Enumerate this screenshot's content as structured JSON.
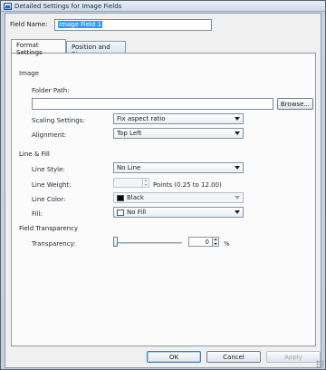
{
  "window": {
    "title": "Detailed Settings for Image Fields"
  },
  "field_name": {
    "label": "Field Name:",
    "value": "Image Field 1"
  },
  "tabs": [
    {
      "label": "Format Settings",
      "active": true
    },
    {
      "label": "Position and Size",
      "active": false
    }
  ],
  "image": {
    "heading": "Image",
    "folder_path_label": "Folder Path:",
    "folder_path_value": "",
    "browse_label": "Browse...",
    "scaling_label": "Scaling Settings:",
    "scaling_value": "Fix aspect ratio",
    "alignment_label": "Alignment:",
    "alignment_value": "Top Left"
  },
  "line_fill": {
    "heading": "Line & Fill",
    "line_style_label": "Line Style:",
    "line_style_value": "No Line",
    "line_weight_label": "Line Weight:",
    "line_weight_value": "",
    "line_weight_unit": "Points (0.25 to 12.00)",
    "line_color_label": "Line Color:",
    "line_color_value": "Black",
    "line_color_hex": "#000000",
    "fill_label": "Fill:",
    "fill_value": "No Fill",
    "fill_hex": "#ffffff"
  },
  "transparency": {
    "heading": "Field Transparency",
    "label": "Transparency:",
    "value": "0",
    "unit": "%",
    "slider_fraction": 0
  },
  "buttons": {
    "ok": "OK",
    "cancel": "Cancel",
    "apply": "Apply"
  },
  "colors": {
    "accent": "#3399ff",
    "client_bg": "#f0f0f0"
  }
}
